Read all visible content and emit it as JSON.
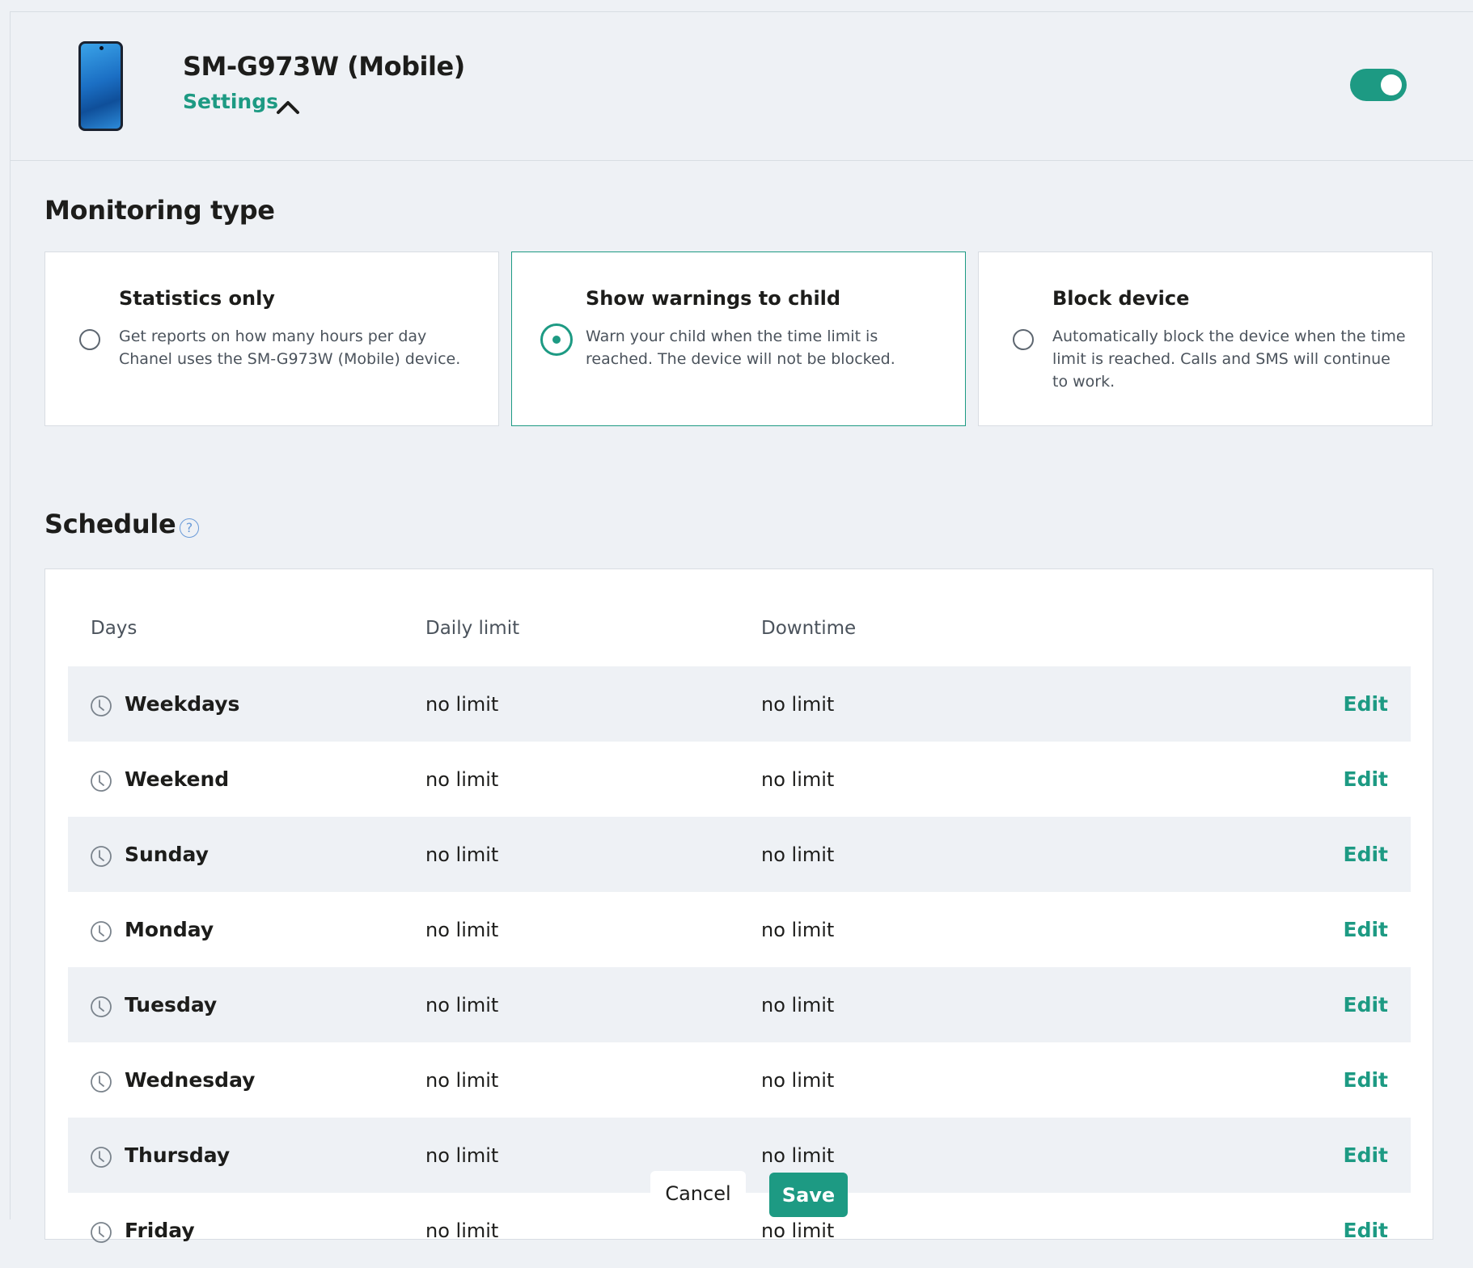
{
  "device": {
    "name": "SM-G973W (Mobile)",
    "settings_label": "Settings",
    "enabled": true,
    "accent_color": "#1d9a83"
  },
  "monitoring": {
    "title": "Monitoring type",
    "options": [
      {
        "title": "Statistics only",
        "description": "Get reports on how many hours per day Chanel uses the SM-G973W (Mobile) device.",
        "selected": false
      },
      {
        "title": "Show warnings to child",
        "description": "Warn your child when the time limit is reached. The device will not be blocked.",
        "selected": true
      },
      {
        "title": "Block device",
        "description": "Automatically block the device when the time limit is reached. Calls and SMS will continue to work.",
        "selected": false
      }
    ]
  },
  "schedule": {
    "title": "Schedule",
    "help_icon": "question-circle-icon",
    "headers": {
      "days": "Days",
      "limit": "Daily limit",
      "downtime": "Downtime"
    },
    "rows": [
      {
        "day": "Weekdays",
        "limit": "no limit",
        "downtime": "no limit",
        "edit": "Edit"
      },
      {
        "day": "Weekend",
        "limit": "no limit",
        "downtime": "no limit",
        "edit": "Edit"
      },
      {
        "day": "Sunday",
        "limit": "no limit",
        "downtime": "no limit",
        "edit": "Edit"
      },
      {
        "day": "Monday",
        "limit": "no limit",
        "downtime": "no limit",
        "edit": "Edit"
      },
      {
        "day": "Tuesday",
        "limit": "no limit",
        "downtime": "no limit",
        "edit": "Edit"
      },
      {
        "day": "Wednesday",
        "limit": "no limit",
        "downtime": "no limit",
        "edit": "Edit"
      },
      {
        "day": "Thursday",
        "limit": "no limit",
        "downtime": "no limit",
        "edit": "Edit"
      },
      {
        "day": "Friday",
        "limit": "no limit",
        "downtime": "no limit",
        "edit": "Edit"
      }
    ]
  },
  "actions": {
    "cancel": "Cancel",
    "save": "Save"
  }
}
